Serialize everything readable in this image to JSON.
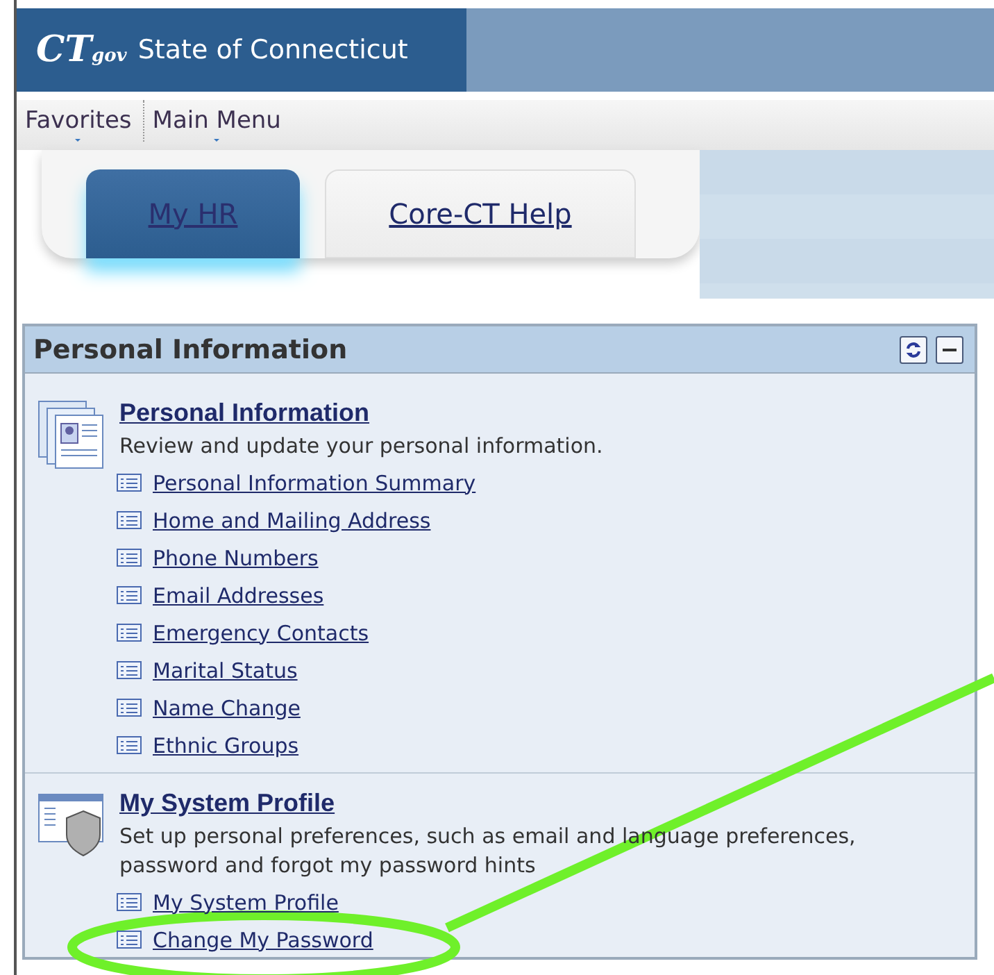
{
  "header": {
    "logo": "CT",
    "logo_suffix": "gov",
    "title": "State of Connecticut"
  },
  "menu": [
    {
      "label": "Favorites"
    },
    {
      "label": "Main Menu"
    }
  ],
  "tabs": [
    {
      "label": "My HR",
      "selected": true
    },
    {
      "label": "Core-CT Help",
      "selected": false
    }
  ],
  "panel": {
    "title": "Personal Information",
    "sections": [
      {
        "kind": "person",
        "title": "Personal Information",
        "description": "Review and update your personal information.",
        "links": [
          "Personal Information Summary",
          "Home and Mailing Address",
          "Phone Numbers",
          "Email Addresses",
          "Emergency Contacts",
          "Marital Status",
          "Name Change",
          "Ethnic Groups"
        ]
      },
      {
        "kind": "shield",
        "title": "My System Profile",
        "description": "Set up personal preferences, such as email and language preferences, password and forgot my password hints",
        "links": [
          "My System Profile",
          "Change My Password"
        ]
      }
    ]
  }
}
